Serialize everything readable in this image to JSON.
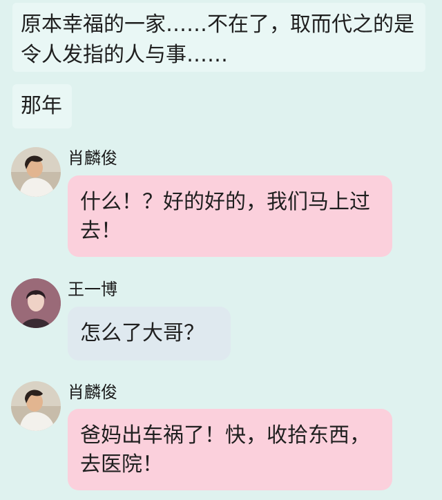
{
  "narration": [
    {
      "text": "原本幸福的一家……不在了，取而代之的是令人发指的人与事……"
    },
    {
      "text": "那年"
    }
  ],
  "messages": [
    {
      "sender": "肖麟俊",
      "text": "什么！？好的好的，我们马上过去！",
      "bubble_color": "#fbd0dc",
      "avatar": "man-reclining-avatar"
    },
    {
      "sender": "王一博",
      "text": "怎么了大哥？",
      "bubble_color": "#dfe9ef",
      "avatar": "young-man-portrait-avatar"
    },
    {
      "sender": "肖麟俊",
      "text": "爸妈出车祸了！快，收拾东西，去医院！",
      "bubble_color": "#fbd0dc",
      "avatar": "man-reclining-avatar"
    }
  ],
  "colors": {
    "background": "#dff2ef",
    "narration_box": "#e9f7f5"
  }
}
